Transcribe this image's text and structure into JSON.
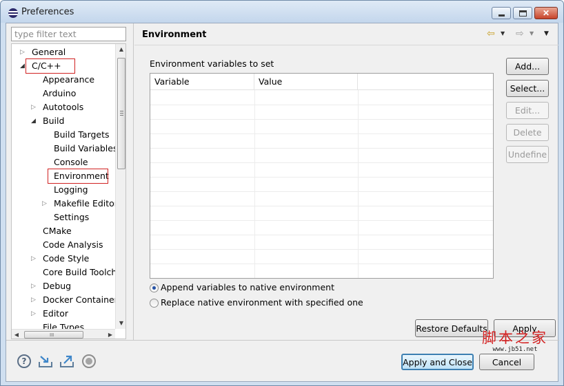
{
  "window": {
    "title": "Preferences",
    "minimize_icon": "minimize-icon",
    "maximize_icon": "maximize-icon",
    "close_glyph": "✕"
  },
  "sidebar": {
    "filter_placeholder": "type filter text",
    "tree": [
      {
        "label": "General",
        "level": 0,
        "expander": "collapsed"
      },
      {
        "label": "C/C++",
        "level": 0,
        "expander": "expanded",
        "highlighted": true
      },
      {
        "label": "Appearance",
        "level": 1,
        "expander": "none"
      },
      {
        "label": "Arduino",
        "level": 1,
        "expander": "none"
      },
      {
        "label": "Autotools",
        "level": 1,
        "expander": "collapsed"
      },
      {
        "label": "Build",
        "level": 1,
        "expander": "expanded"
      },
      {
        "label": "Build Targets",
        "level": 2,
        "expander": "none"
      },
      {
        "label": "Build Variables",
        "level": 2,
        "expander": "none"
      },
      {
        "label": "Console",
        "level": 2,
        "expander": "none"
      },
      {
        "label": "Environment",
        "level": 2,
        "expander": "none",
        "selected": true
      },
      {
        "label": "Logging",
        "level": 2,
        "expander": "none"
      },
      {
        "label": "Makefile Editor",
        "level": 2,
        "expander": "collapsed"
      },
      {
        "label": "Settings",
        "level": 2,
        "expander": "none"
      },
      {
        "label": "CMake",
        "level": 1,
        "expander": "none"
      },
      {
        "label": "Code Analysis",
        "level": 1,
        "expander": "none"
      },
      {
        "label": "Code Style",
        "level": 1,
        "expander": "collapsed"
      },
      {
        "label": "Core Build Toolcha",
        "level": 1,
        "expander": "none"
      },
      {
        "label": "Debug",
        "level": 1,
        "expander": "collapsed"
      },
      {
        "label": "Docker Container",
        "level": 1,
        "expander": "collapsed"
      },
      {
        "label": "Editor",
        "level": 1,
        "expander": "collapsed"
      },
      {
        "label": "File Types",
        "level": 1,
        "expander": "none"
      }
    ],
    "hscroll_grip": "III"
  },
  "page": {
    "title": "Environment",
    "nav_back_glyph": "⇦",
    "nav_fwd_glyph": "⇨",
    "dropdown_glyph": "▼",
    "section_label": "Environment variables to set",
    "table": {
      "columns": [
        "Variable",
        "Value",
        ""
      ]
    },
    "side_buttons": [
      {
        "label": "Add...",
        "enabled": true
      },
      {
        "label": "Select...",
        "enabled": true
      },
      {
        "label": "Edit...",
        "enabled": false
      },
      {
        "label": "Delete",
        "enabled": false
      },
      {
        "label": "Undefine",
        "enabled": false
      }
    ],
    "radios": [
      {
        "label": "Append variables to native environment",
        "checked": true
      },
      {
        "label": "Replace native environment with specified one",
        "checked": false
      }
    ],
    "restore_defaults": "Restore Defaults",
    "apply": "Apply"
  },
  "footer": {
    "help_glyph": "?",
    "apply_and_close": "Apply and Close",
    "cancel": "Cancel"
  },
  "watermark": {
    "main": "脚本之家",
    "url": "www.jb51.net"
  }
}
